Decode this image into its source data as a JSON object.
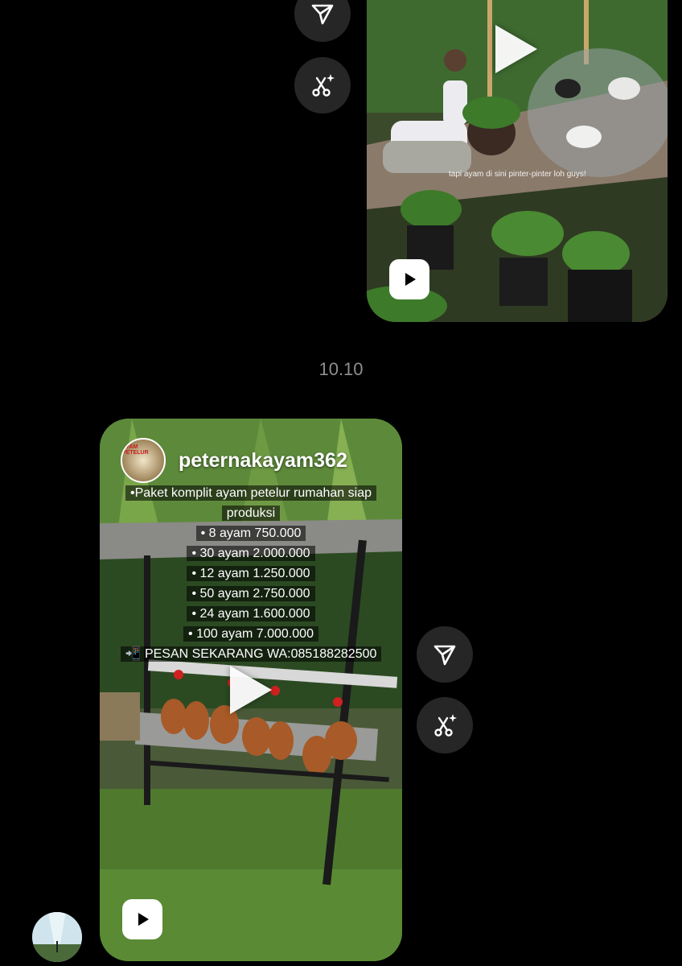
{
  "timestamp": "10.10",
  "reel_top": {
    "caption": "tapi ayam di sini pinter-pinter loh guys!"
  },
  "reel_bottom": {
    "username": "peternakayam362",
    "logo_text": "AYAM PETELUR",
    "lines": [
      "•Paket komplit ayam petelur rumahan siap",
      "produksi",
      "• 8 ayam 750.000",
      "• 30 ayam 2.000.000",
      "• 12 ayam 1.250.000",
      "• 50 ayam 2.750.000",
      "• 24 ayam 1.600.000",
      "• 100 ayam 7.000.000",
      "📲 PESAN SEKARANG  WA:085188282500"
    ]
  },
  "icons": {
    "send": "send-icon",
    "remix": "remix-icon",
    "reels": "reels-icon",
    "play": "play-icon"
  }
}
